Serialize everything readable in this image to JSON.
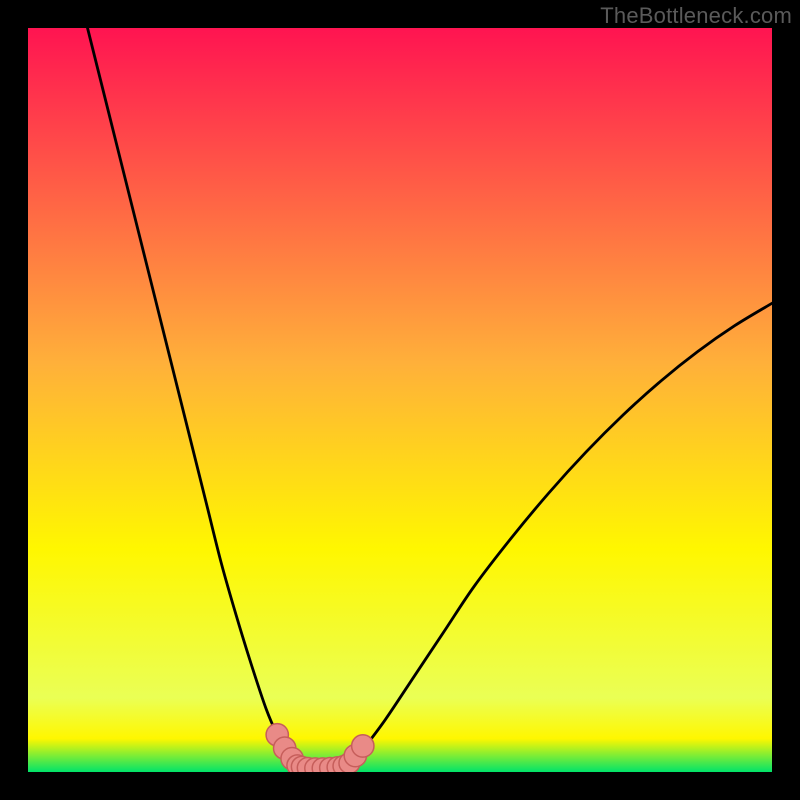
{
  "watermark": "TheBottleneck.com",
  "colors": {
    "frame": "#000000",
    "curve": "#000000",
    "marker_fill": "#e98a87",
    "marker_stroke": "#c65e5b",
    "grad_top": "#ff1451",
    "grad_mid1": "#ffb03a",
    "grad_mid2": "#fff700",
    "grad_mid3": "#eaff55",
    "grad_bottom": "#00e36a"
  },
  "gradient_stops": [
    {
      "offset": 0.0,
      "key": "grad_top"
    },
    {
      "offset": 0.45,
      "key": "grad_mid1"
    },
    {
      "offset": 0.7,
      "key": "grad_mid2"
    },
    {
      "offset": 0.9,
      "key": "grad_mid3"
    },
    {
      "offset": 0.955,
      "key": "grad_mid2"
    },
    {
      "offset": 1.0,
      "key": "grad_bottom"
    }
  ],
  "chart_data": {
    "type": "line",
    "title": "",
    "xlabel": "",
    "ylabel": "",
    "xlim": [
      0,
      100
    ],
    "ylim": [
      0,
      100
    ],
    "series": [
      {
        "name": "left-curve",
        "x": [
          8,
          10,
          12,
          14,
          16,
          18,
          20,
          22,
          24,
          26,
          28,
          30,
          32,
          33.5,
          35,
          36.5
        ],
        "values": [
          100,
          92,
          84,
          76,
          68,
          60,
          52,
          44,
          36,
          28,
          21,
          14.5,
          8.5,
          5,
          2.3,
          0.5
        ]
      },
      {
        "name": "right-curve",
        "x": [
          43,
          45,
          48,
          52,
          56,
          60,
          65,
          70,
          75,
          80,
          85,
          90,
          95,
          100
        ],
        "values": [
          0.5,
          3,
          7,
          13,
          19,
          25,
          31.5,
          37.5,
          43,
          48,
          52.5,
          56.5,
          60,
          63
        ]
      }
    ],
    "markers": [
      {
        "x": 33.5,
        "y": 5.0,
        "r": 1.5
      },
      {
        "x": 34.5,
        "y": 3.2,
        "r": 1.5
      },
      {
        "x": 35.5,
        "y": 1.8,
        "r": 1.5
      },
      {
        "x": 36.2,
        "y": 0.9,
        "r": 1.4
      },
      {
        "x": 36.8,
        "y": 0.7,
        "r": 1.4
      },
      {
        "x": 37.6,
        "y": 0.55,
        "r": 1.4
      },
      {
        "x": 38.6,
        "y": 0.5,
        "r": 1.4
      },
      {
        "x": 39.6,
        "y": 0.5,
        "r": 1.4
      },
      {
        "x": 40.6,
        "y": 0.55,
        "r": 1.4
      },
      {
        "x": 41.6,
        "y": 0.65,
        "r": 1.4
      },
      {
        "x": 42.4,
        "y": 0.8,
        "r": 1.4
      },
      {
        "x": 43.2,
        "y": 1.2,
        "r": 1.4
      },
      {
        "x": 44.0,
        "y": 2.2,
        "r": 1.5
      },
      {
        "x": 45.0,
        "y": 3.5,
        "r": 1.5
      }
    ]
  }
}
